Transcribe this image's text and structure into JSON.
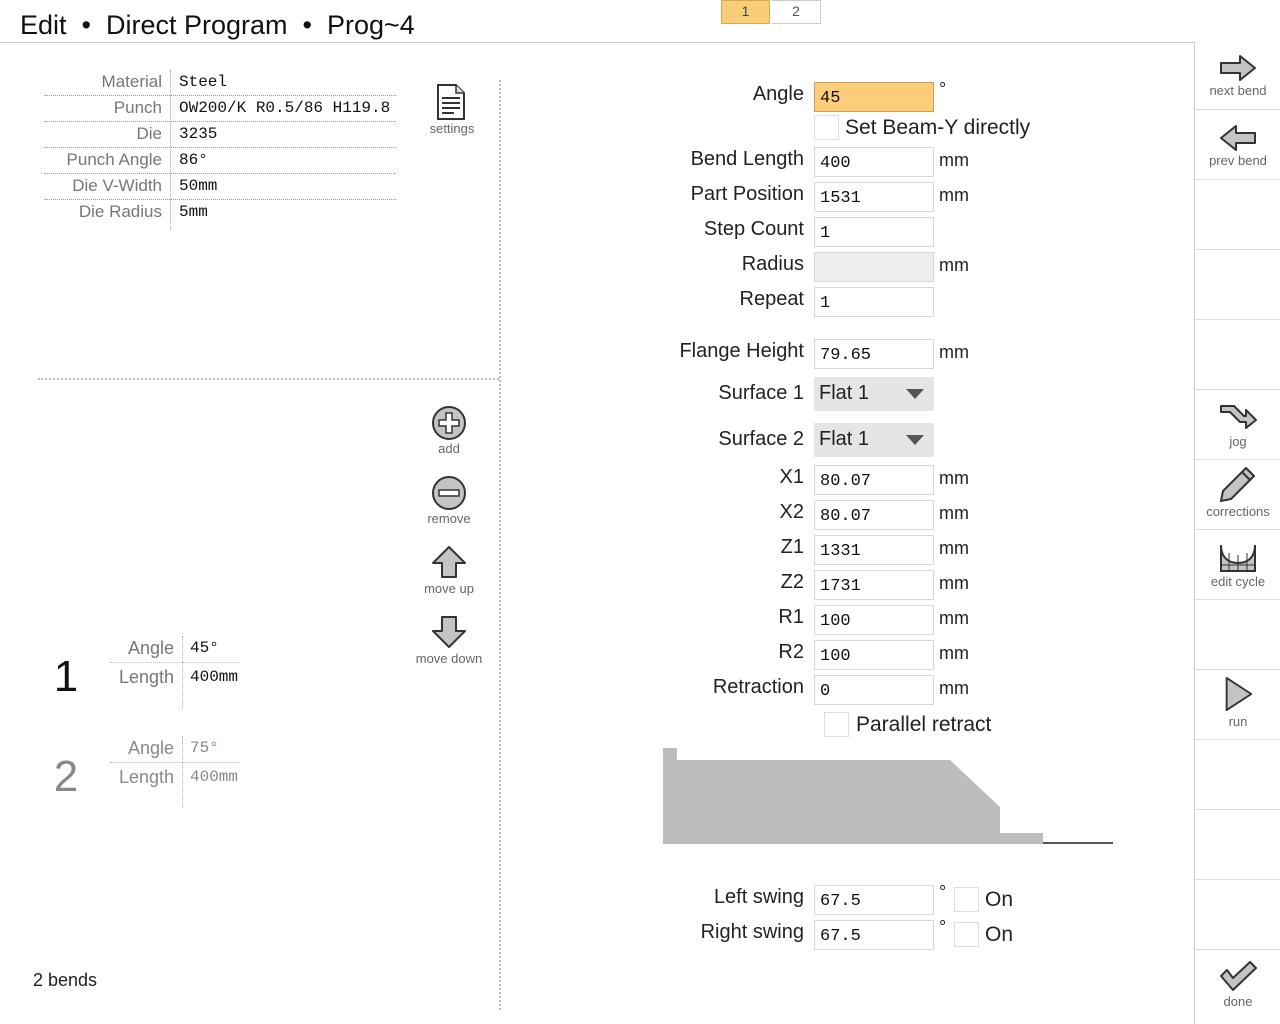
{
  "header": {
    "title": "Edit  •  Direct Program  •  Prog~4",
    "page_tabs": [
      "1",
      "2"
    ]
  },
  "tooling": [
    {
      "label": "Material",
      "value": "Steel"
    },
    {
      "label": "Punch",
      "value": "OW200/K R0.5/86 H119.8"
    },
    {
      "label": "Die",
      "value": "3235"
    },
    {
      "label": "Punch Angle",
      "value": "86°"
    },
    {
      "label": "Die V-Width",
      "value": "50mm"
    },
    {
      "label": "Die Radius",
      "value": "5mm"
    }
  ],
  "tools": {
    "settings": "settings",
    "add": "add",
    "remove": "remove",
    "move_up": "move up",
    "move_down": "move down"
  },
  "bends": [
    {
      "number": "1",
      "angle_label": "Angle",
      "angle": "45°",
      "length_label": "Length",
      "length": "400mm"
    },
    {
      "number": "2",
      "angle_label": "Angle",
      "angle": "75°",
      "length_label": "Length",
      "length": "400mm"
    }
  ],
  "bends_count": "2 bends",
  "form": {
    "angle": {
      "label": "Angle",
      "value": "45",
      "unit": "°"
    },
    "set_beam_y": {
      "label": "Set Beam-Y directly",
      "checked": false
    },
    "bend_length": {
      "label": "Bend Length",
      "value": "400",
      "unit": "mm"
    },
    "part_position": {
      "label": "Part Position",
      "value": "1531",
      "unit": "mm"
    },
    "step_count": {
      "label": "Step Count",
      "value": "1"
    },
    "radius": {
      "label": "Radius",
      "value": "",
      "unit": "mm"
    },
    "repeat": {
      "label": "Repeat",
      "value": "1"
    },
    "flange_height": {
      "label": "Flange Height",
      "value": "79.65",
      "unit": "mm"
    },
    "surface1": {
      "label": "Surface 1",
      "value": "Flat 1"
    },
    "surface2": {
      "label": "Surface 2",
      "value": "Flat 1"
    },
    "x1": {
      "label": "X1",
      "value": "80.07",
      "unit": "mm"
    },
    "x2": {
      "label": "X2",
      "value": "80.07",
      "unit": "mm"
    },
    "z1": {
      "label": "Z1",
      "value": "1331",
      "unit": "mm"
    },
    "z2": {
      "label": "Z2",
      "value": "1731",
      "unit": "mm"
    },
    "r1": {
      "label": "R1",
      "value": "100",
      "unit": "mm"
    },
    "r2": {
      "label": "R2",
      "value": "100",
      "unit": "mm"
    },
    "retraction": {
      "label": "Retraction",
      "value": "0",
      "unit": "mm"
    },
    "parallel_retract": {
      "label": "Parallel retract",
      "checked": false
    },
    "left_swing": {
      "label": "Left swing",
      "value": "67.5",
      "unit": "°",
      "on_label": "On",
      "on": false
    },
    "right_swing": {
      "label": "Right swing",
      "value": "67.5",
      "unit": "°",
      "on_label": "On",
      "on": false
    }
  },
  "sidebar": {
    "next_bend": "next bend",
    "prev_bend": "prev bend",
    "jog": "jog",
    "corrections": "corrections",
    "edit_cycle": "edit cycle",
    "run": "run",
    "done": "done"
  },
  "colors": {
    "active_field": "#fdcd79",
    "page_tab_active": "#f8cd78",
    "profile_fill": "#bdbdbd"
  }
}
